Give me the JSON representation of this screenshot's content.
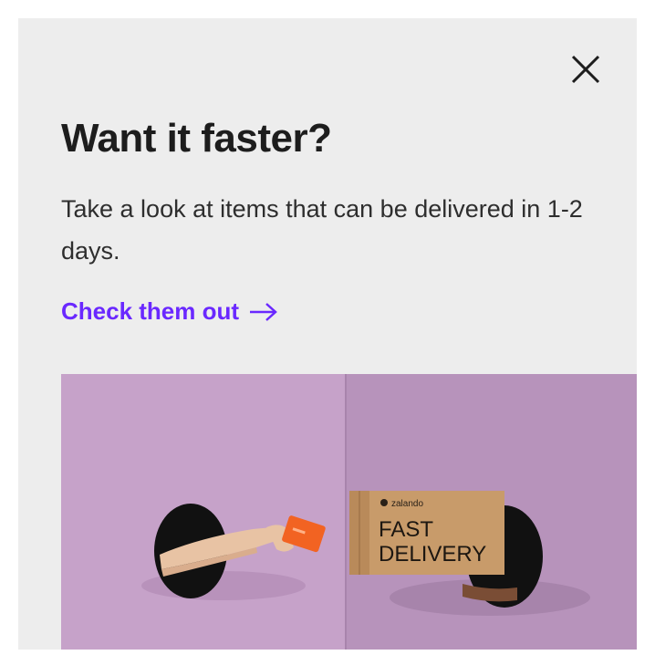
{
  "modal": {
    "title": "Want it faster?",
    "body": "Take a look at items that can be delivered in 1-2 days.",
    "cta_label": "Check them out",
    "close_icon": "close-icon",
    "cta_icon": "arrow-right-icon"
  },
  "promo_image": {
    "box_brand": "zalando",
    "box_line1": "FAST",
    "box_line2": "DELIVERY"
  },
  "colors": {
    "background": "#ededed",
    "title": "#1d1d1d",
    "accent": "#6a28ff",
    "image_wall": "#c6a2c9",
    "card": "#f26322",
    "box": "#c89b6a"
  }
}
